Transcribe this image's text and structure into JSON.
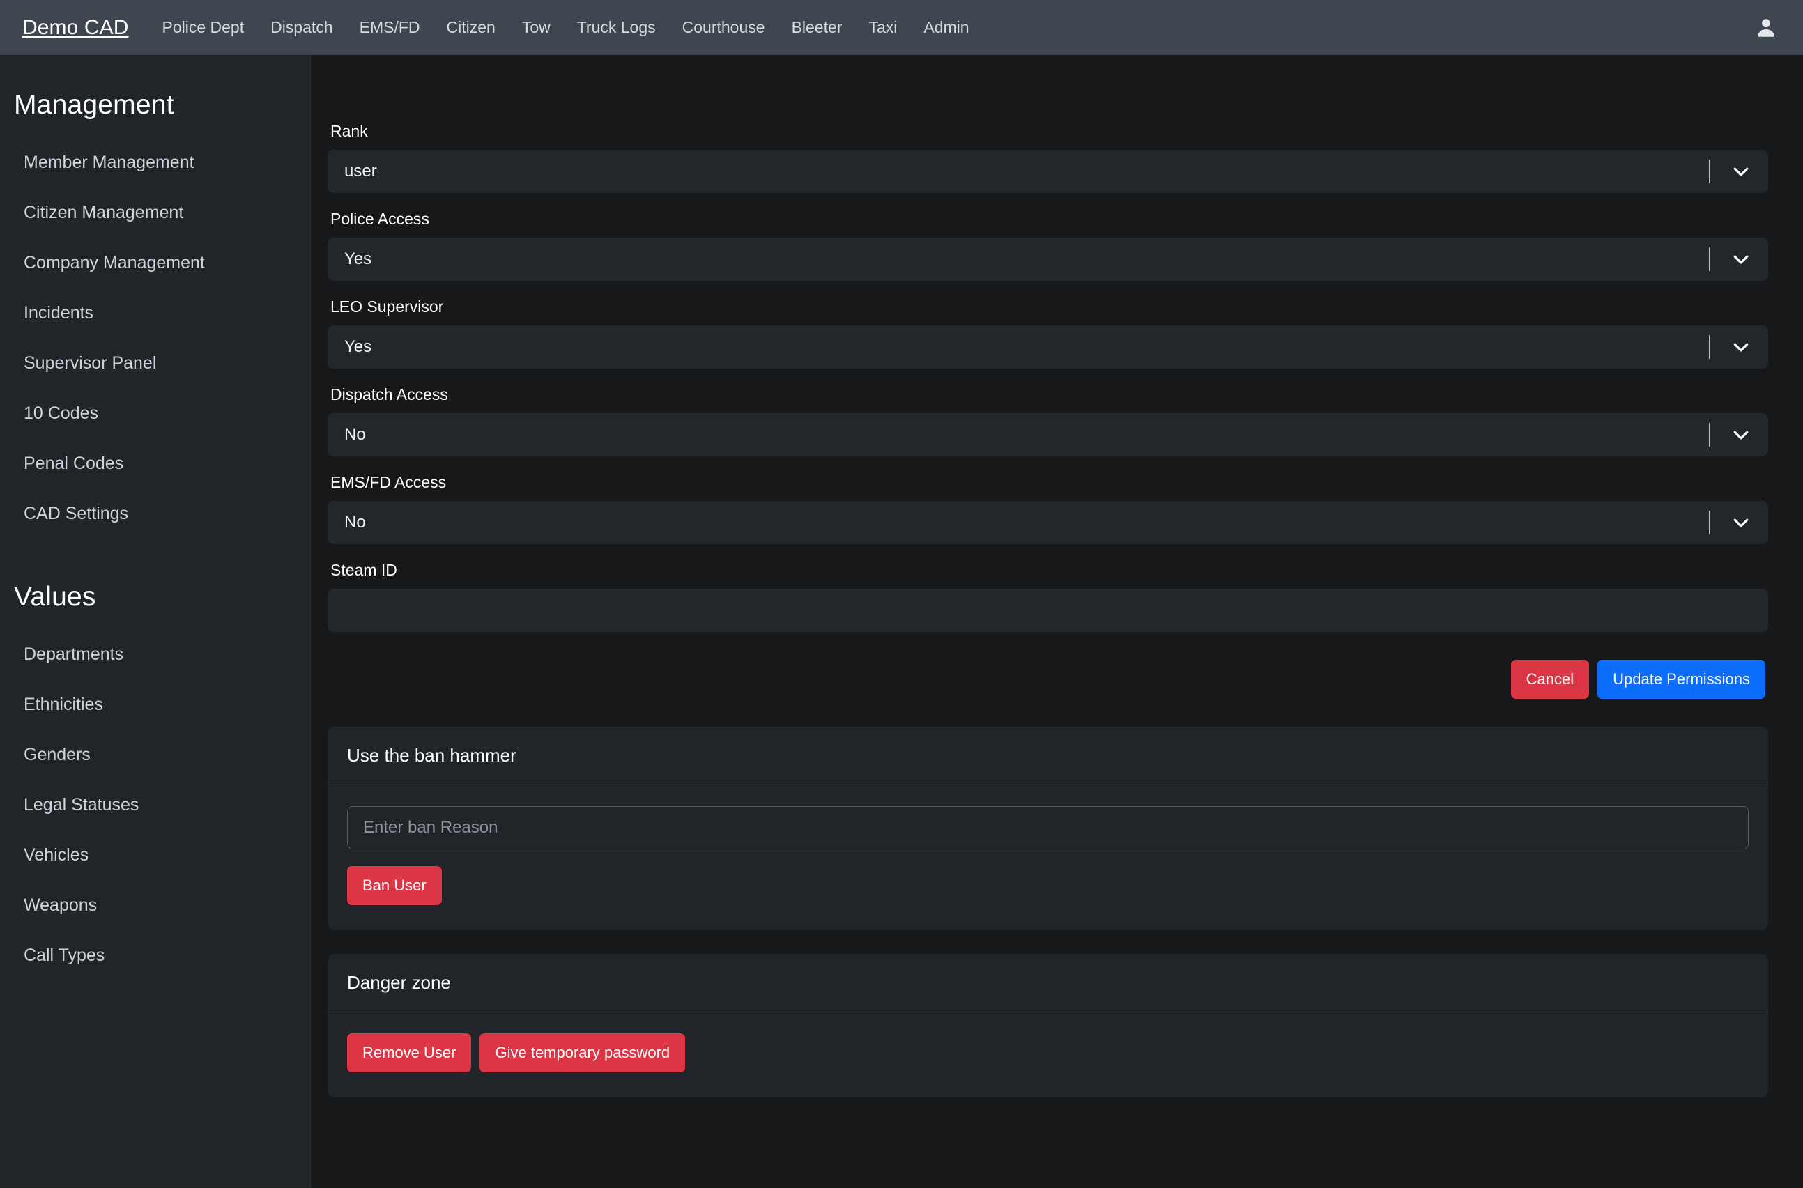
{
  "navbar": {
    "brand": "Demo CAD",
    "links": [
      {
        "label": "Police Dept"
      },
      {
        "label": "Dispatch"
      },
      {
        "label": "EMS/FD"
      },
      {
        "label": "Citizen"
      },
      {
        "label": "Tow"
      },
      {
        "label": "Truck Logs"
      },
      {
        "label": "Courthouse"
      },
      {
        "label": "Bleeter"
      },
      {
        "label": "Taxi"
      },
      {
        "label": "Admin"
      }
    ],
    "avatar_icon": "user-icon"
  },
  "sidebar": {
    "management_heading": "Management",
    "management_items": [
      {
        "label": "Member Management"
      },
      {
        "label": "Citizen Management"
      },
      {
        "label": "Company Management"
      },
      {
        "label": "Incidents"
      },
      {
        "label": "Supervisor Panel"
      },
      {
        "label": "10 Codes"
      },
      {
        "label": "Penal Codes"
      },
      {
        "label": "CAD Settings"
      }
    ],
    "values_heading": "Values",
    "values_items": [
      {
        "label": "Departments"
      },
      {
        "label": "Ethnicities"
      },
      {
        "label": "Genders"
      },
      {
        "label": "Legal Statuses"
      },
      {
        "label": "Vehicles"
      },
      {
        "label": "Weapons"
      },
      {
        "label": "Call Types"
      }
    ]
  },
  "permissions_form": {
    "fields": [
      {
        "label": "Rank",
        "value": "user",
        "type": "select"
      },
      {
        "label": "Police Access",
        "value": "Yes",
        "type": "select"
      },
      {
        "label": "LEO Supervisor",
        "value": "Yes",
        "type": "select"
      },
      {
        "label": "Dispatch Access",
        "value": "No",
        "type": "select"
      },
      {
        "label": "EMS/FD Access",
        "value": "No",
        "type": "select"
      }
    ],
    "steam_id_label": "Steam ID",
    "steam_id_value": "",
    "steam_id_placeholder": "",
    "cancel_label": "Cancel",
    "update_label": "Update Permissions"
  },
  "ban_card": {
    "title": "Use the ban hammer",
    "reason_value": "",
    "reason_placeholder": "Enter ban Reason",
    "ban_button_label": "Ban User"
  },
  "danger_card": {
    "title": "Danger zone",
    "remove_user_label": "Remove User",
    "temp_password_label": "Give temporary password"
  },
  "colors": {
    "navbar_bg": "#3e464f",
    "sidebar_bg": "#212529",
    "main_bg": "#161819",
    "input_bg": "#23272b",
    "danger": "#dc3545",
    "primary": "#0d6efd"
  }
}
